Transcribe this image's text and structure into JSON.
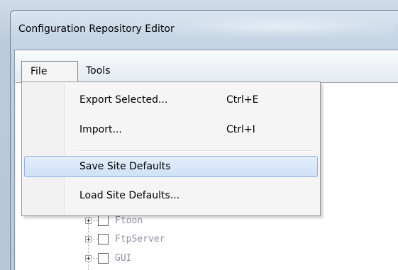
{
  "window": {
    "title": "Configuration Repository Editor"
  },
  "menubar": {
    "items": [
      {
        "label": "File"
      },
      {
        "label": "Tools"
      }
    ]
  },
  "file_menu": {
    "items": [
      {
        "label": "Export Selected...",
        "shortcut": "Ctrl+E",
        "highlighted": false
      },
      {
        "label": "Import...",
        "shortcut": "Ctrl+I",
        "highlighted": false
      },
      {
        "label": "Save Site Defaults",
        "shortcut": "",
        "highlighted": true
      },
      {
        "label": "Load Site Defaults...",
        "shortcut": "",
        "highlighted": false
      }
    ]
  },
  "tree": {
    "items": [
      {
        "label": "Ftoon",
        "checked": false
      },
      {
        "label": "FtpServer",
        "checked": false
      },
      {
        "label": "GUI",
        "checked": false
      }
    ]
  },
  "colors": {
    "highlight_border": "#8fb3e3",
    "tree_text": "#8b93a3"
  }
}
